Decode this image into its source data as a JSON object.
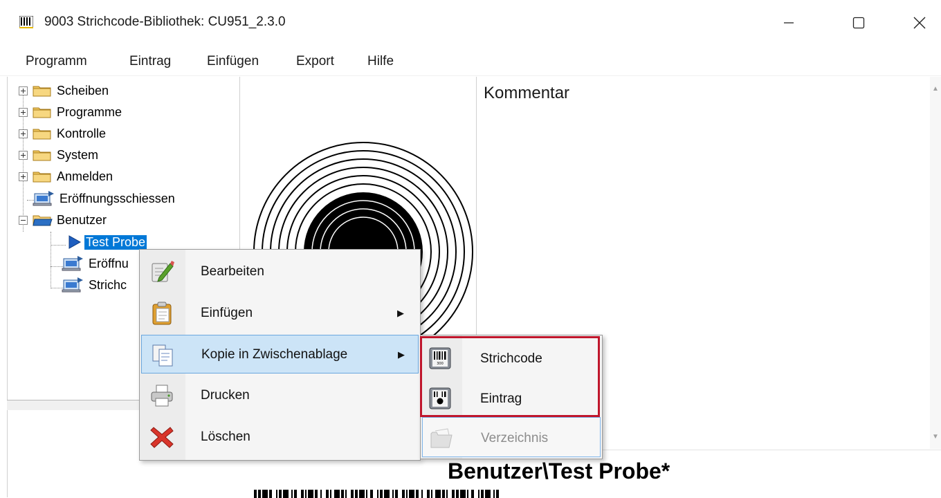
{
  "window": {
    "title": "9003 Strichcode-Bibliothek: CU951_2.3.0",
    "app_icon": "barcode-icon",
    "controls": [
      "minimize-icon",
      "maximize-icon",
      "close-icon"
    ]
  },
  "menubar": {
    "items": [
      "Programm",
      "Eintrag",
      "Einfügen",
      "Export",
      "Hilfe"
    ]
  },
  "tree": {
    "nodes": [
      {
        "label": "Scheiben",
        "icon": "folder-icon",
        "expander": "+"
      },
      {
        "label": "Programme",
        "icon": "folder-icon",
        "expander": "+"
      },
      {
        "label": "Kontrolle",
        "icon": "folder-icon",
        "expander": "+"
      },
      {
        "label": "System",
        "icon": "folder-icon",
        "expander": "+"
      },
      {
        "label": "Anmelden",
        "icon": "folder-icon",
        "expander": "+"
      },
      {
        "label": "Eröffnungsschiessen",
        "icon": "computer-entry-icon"
      },
      {
        "label": "Benutzer",
        "icon": "folder-open-icon",
        "expander": "−"
      },
      {
        "label": "Test Probe",
        "icon": "play-arrow-icon",
        "selected": true
      },
      {
        "label": "Eröffnu",
        "icon": "computer-entry-icon"
      },
      {
        "label": "Strichc",
        "icon": "computer-entry-icon"
      }
    ]
  },
  "comment": {
    "title": "Kommentar"
  },
  "bottom": {
    "title": "Benutzer\\Test Probe*"
  },
  "context_menu": {
    "items": [
      {
        "label": "Bearbeiten",
        "icon": "edit-pencil-icon"
      },
      {
        "label": "Einfügen",
        "icon": "clipboard-icon",
        "submenu": true
      },
      {
        "label": "Kopie in Zwischenablage",
        "icon": "copy-icon",
        "submenu": true,
        "highlighted": true
      },
      {
        "label": "Drucken",
        "icon": "printer-icon"
      },
      {
        "label": "Löschen",
        "icon": "delete-x-icon"
      }
    ]
  },
  "submenu": {
    "items": [
      {
        "label": "Strichcode",
        "icon": "barcode-card-icon"
      },
      {
        "label": "Eintrag",
        "icon": "entry-card-icon"
      },
      {
        "label": "Verzeichnis",
        "icon": "folder-disabled-icon",
        "disabled": true
      }
    ]
  },
  "colors": {
    "selection": "#0078d7",
    "menu_highlight": "#cce4f7",
    "annotation_box": "#c0162c"
  }
}
